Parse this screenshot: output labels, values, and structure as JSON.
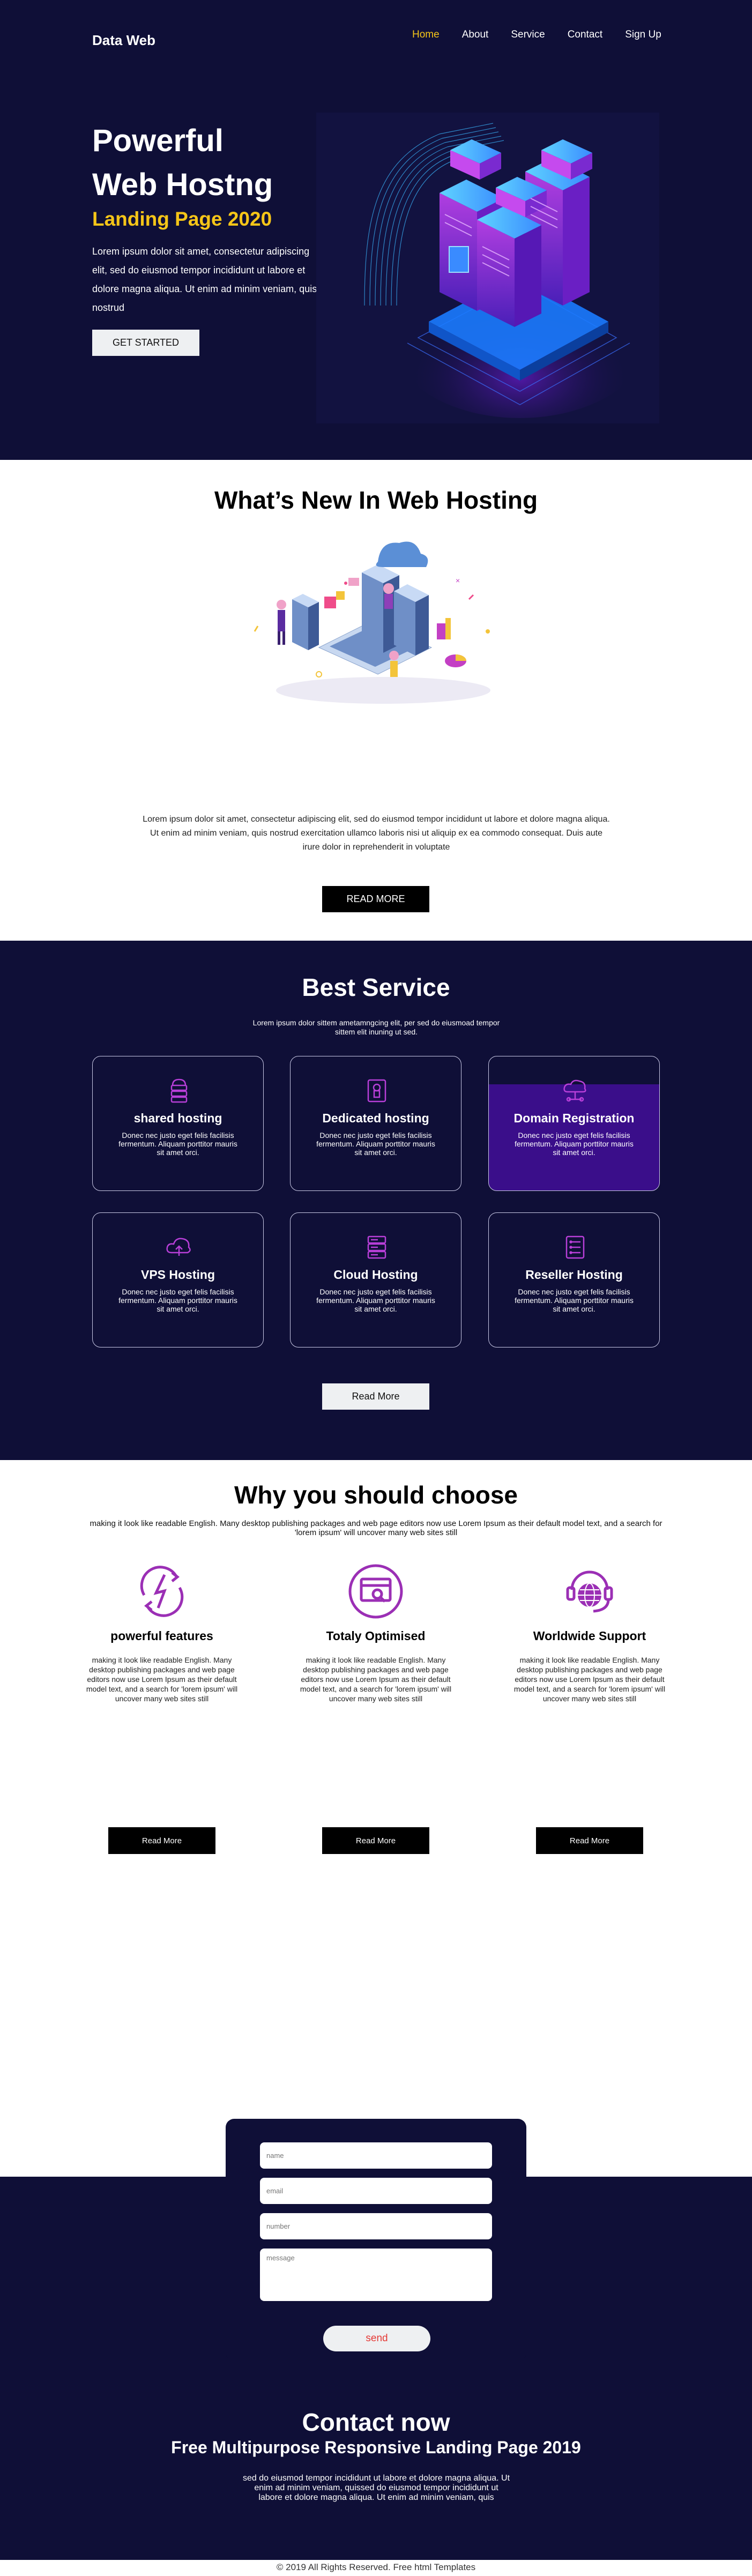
{
  "brand": "Data Web",
  "nav": [
    {
      "label": "Home",
      "active": true
    },
    {
      "label": "About",
      "active": false
    },
    {
      "label": "Service",
      "active": false
    },
    {
      "label": "Contact",
      "active": false
    },
    {
      "label": "Sign Up",
      "active": false
    }
  ],
  "hero": {
    "title_line1": "Powerful",
    "title_line2": "Web Hostng",
    "subtitle": "Landing Page 2020",
    "text": "Lorem ipsum dolor sit amet, consectetur adipiscing elit, sed do eiusmod tempor incididunt ut labore et dolore magna aliqua. Ut enim ad minim veniam, quis nostrud",
    "button": "GET STARTED"
  },
  "news": {
    "title": "What’s New In Web Hosting",
    "text": "Lorem ipsum dolor sit amet, consectetur adipiscing elit, sed do eiusmod tempor incididunt ut labore et dolore magna aliqua. Ut enim ad minim veniam, quis nostrud exercitation ullamco laboris nisi ut aliquip ex ea commodo consequat. Duis aute irure dolor in reprehenderit in voluptate",
    "button": "READ MORE"
  },
  "services": {
    "title": "Best Service",
    "lead": "Lorem ipsum dolor sittem ametamngcing elit, per sed do eiusmoad tempor sittem elit inuning ut sed.",
    "cards": [
      {
        "title": "shared hosting",
        "text": "Donec nec justo eget felis facilisis fermentum. Aliquam porttitor mauris sit amet orci.",
        "icon": "server-stack-icon"
      },
      {
        "title": "Dedicated hosting",
        "text": "Donec nec justo eget felis facilisis fermentum. Aliquam porttitor mauris sit amet orci.",
        "icon": "secure-server-icon"
      },
      {
        "title": "Domain Registration",
        "text": "Donec nec justo eget felis facilisis fermentum. Aliquam porttitor mauris sit amet orci.",
        "icon": "cloud-network-icon"
      },
      {
        "title": "VPS Hosting",
        "text": "Donec nec justo eget felis facilisis fermentum. Aliquam porttitor mauris sit amet orci.",
        "icon": "cloud-upload-icon"
      },
      {
        "title": "Cloud Hosting",
        "text": "Donec nec justo eget felis facilisis fermentum. Aliquam porttitor mauris sit amet orci.",
        "icon": "server-rack-icon"
      },
      {
        "title": "Reseller Hosting",
        "text": "Donec nec justo eget felis facilisis fermentum. Aliquam porttitor mauris sit amet orci.",
        "icon": "server-list-icon"
      }
    ],
    "button": "Read More"
  },
  "why": {
    "title": "Why you should choose",
    "lead": "making it look like readable English. Many desktop publishing packages and web page editors now use Lorem Ipsum as their default model text, and a search for 'lorem ipsum' will uncover many web sites still",
    "features": [
      {
        "title": "powerful features",
        "text": "making it look like readable English. Many desktop publishing packages and web page editors now use Lorem Ipsum as their default model text, and a search for 'lorem ipsum' will uncover many web sites still",
        "button": "Read More",
        "icon": "lightning-cycle-icon"
      },
      {
        "title": "Totaly Optimised",
        "text": "making it look like readable English. Many desktop publishing packages and web page editors now use Lorem Ipsum as their default model text, and a search for 'lorem ipsum' will uncover many web sites still",
        "button": "Read More",
        "icon": "browser-search-icon"
      },
      {
        "title": "Worldwide Support",
        "text": "making it look like readable English. Many desktop publishing packages and web page editors now use Lorem Ipsum as their default model text, and a search for 'lorem ipsum' will uncover many web sites still",
        "button": "Read More",
        "icon": "globe-support-icon"
      }
    ]
  },
  "contact": {
    "placeholders": {
      "name": "name",
      "email": "email",
      "number": "number",
      "message": "message"
    },
    "send": "send",
    "title": "Contact now",
    "subtitle": "Free Multipurpose Responsive Landing Page 2019",
    "text": "sed do eiusmod tempor incididunt ut labore et dolore magna aliqua. Ut enim ad minim veniam, quissed do eiusmod tempor incididunt ut labore et dolore magna aliqua. Ut enim ad minim veniam, quis"
  },
  "footer": "© 2019 All Rights Reserved. Free html Templates",
  "colors": {
    "navy": "#0f0f37",
    "accent_yellow": "#f5c518",
    "purple": "#8e24aa",
    "highlight": "#3a0e8a"
  }
}
